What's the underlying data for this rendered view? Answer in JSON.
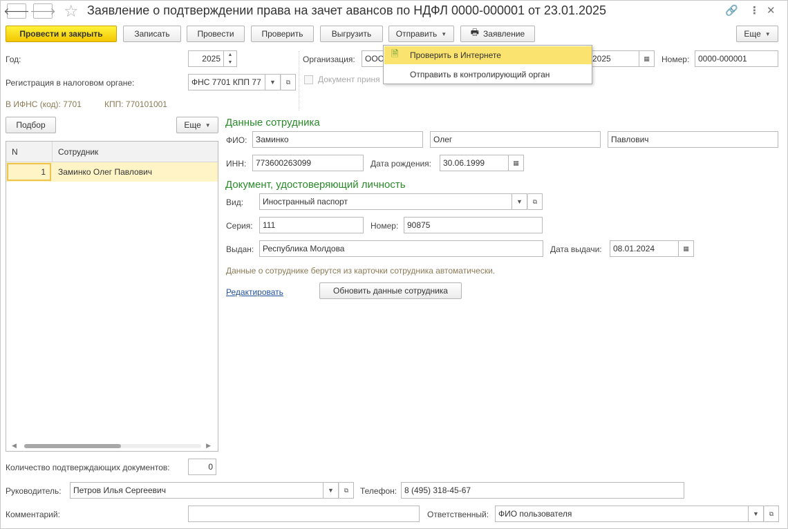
{
  "window": {
    "title": "Заявление о подтверждении права на зачет авансов по НДФЛ 0000-000001 от 23.01.2025",
    "back_icon": "arrow-left-icon",
    "forward_icon": "arrow-right-icon",
    "favorite_icon": "star-icon",
    "link_icon": "link-icon",
    "more_icon": "more-vertical-icon",
    "close_icon": "close-icon"
  },
  "toolbar": {
    "post_close": "Провести и закрыть",
    "save": "Записать",
    "post": "Провести",
    "check": "Проверить",
    "export": "Выгрузить",
    "send": "Отправить",
    "statement": "Заявление",
    "more": "Еще"
  },
  "send_menu": {
    "items": [
      {
        "label": "Проверить в Интернете",
        "icon": "check-document-icon"
      },
      {
        "label": "Отправить в контролирующий орган",
        "icon": ""
      }
    ]
  },
  "header": {
    "year_label": "Год:",
    "year_value": "2025",
    "organization_label": "Организация:",
    "organization_value": "ООО",
    "date_value": "2025",
    "number_label": "Номер:",
    "number_value": "0000-000001",
    "registration_label": "Регистрация в налоговом органе:",
    "registration_value": "ФНС 7701 КПП 77",
    "accepted_label": "Документ приня",
    "ifns_label": "В ИФНС (код): 7701",
    "kpp_label": "КПП: 770101001"
  },
  "list": {
    "select_button": "Подбор",
    "more_button": "Еще",
    "col_n": "N",
    "col_employee": "Сотрудник",
    "rows": [
      {
        "n": "1",
        "employee": "Заминко Олег Павлович"
      }
    ]
  },
  "employee": {
    "section_title": "Данные сотрудника",
    "fio_label": "ФИО:",
    "last_name": "Заминко",
    "first_name": "Олег",
    "middle_name": "Павлович",
    "inn_label": "ИНН:",
    "inn_value": "773600263099",
    "birth_label": "Дата рождения:",
    "birth_value": "30.06.1999"
  },
  "id_document": {
    "section_title": "Документ, удостоверяющий личность",
    "type_label": "Вид:",
    "type_value": "Иностранный паспорт",
    "series_label": "Серия:",
    "series_value": "111",
    "number_label": "Номер:",
    "number_value": "90875",
    "issued_label": "Выдан:",
    "issued_value": "Республика Молдова",
    "issue_date_label": "Дата выдачи:",
    "issue_date_value": "08.01.2024",
    "note": "Данные о сотруднике берутся из карточки сотрудника автоматически.",
    "edit_link": "Редактировать",
    "refresh_button": "Обновить данные сотрудника"
  },
  "footer": {
    "docs_count_label": "Количество подтверждающих документов:",
    "docs_count_value": "0",
    "head_label": "Руководитель:",
    "head_value": "Петров Илья Сергеевич",
    "phone_label": "Телефон:",
    "phone_value": "8 (495) 318-45-67",
    "comment_label": "Комментарий:",
    "comment_value": "",
    "responsible_label": "Ответственный:",
    "responsible_value": "ФИО пользователя"
  }
}
